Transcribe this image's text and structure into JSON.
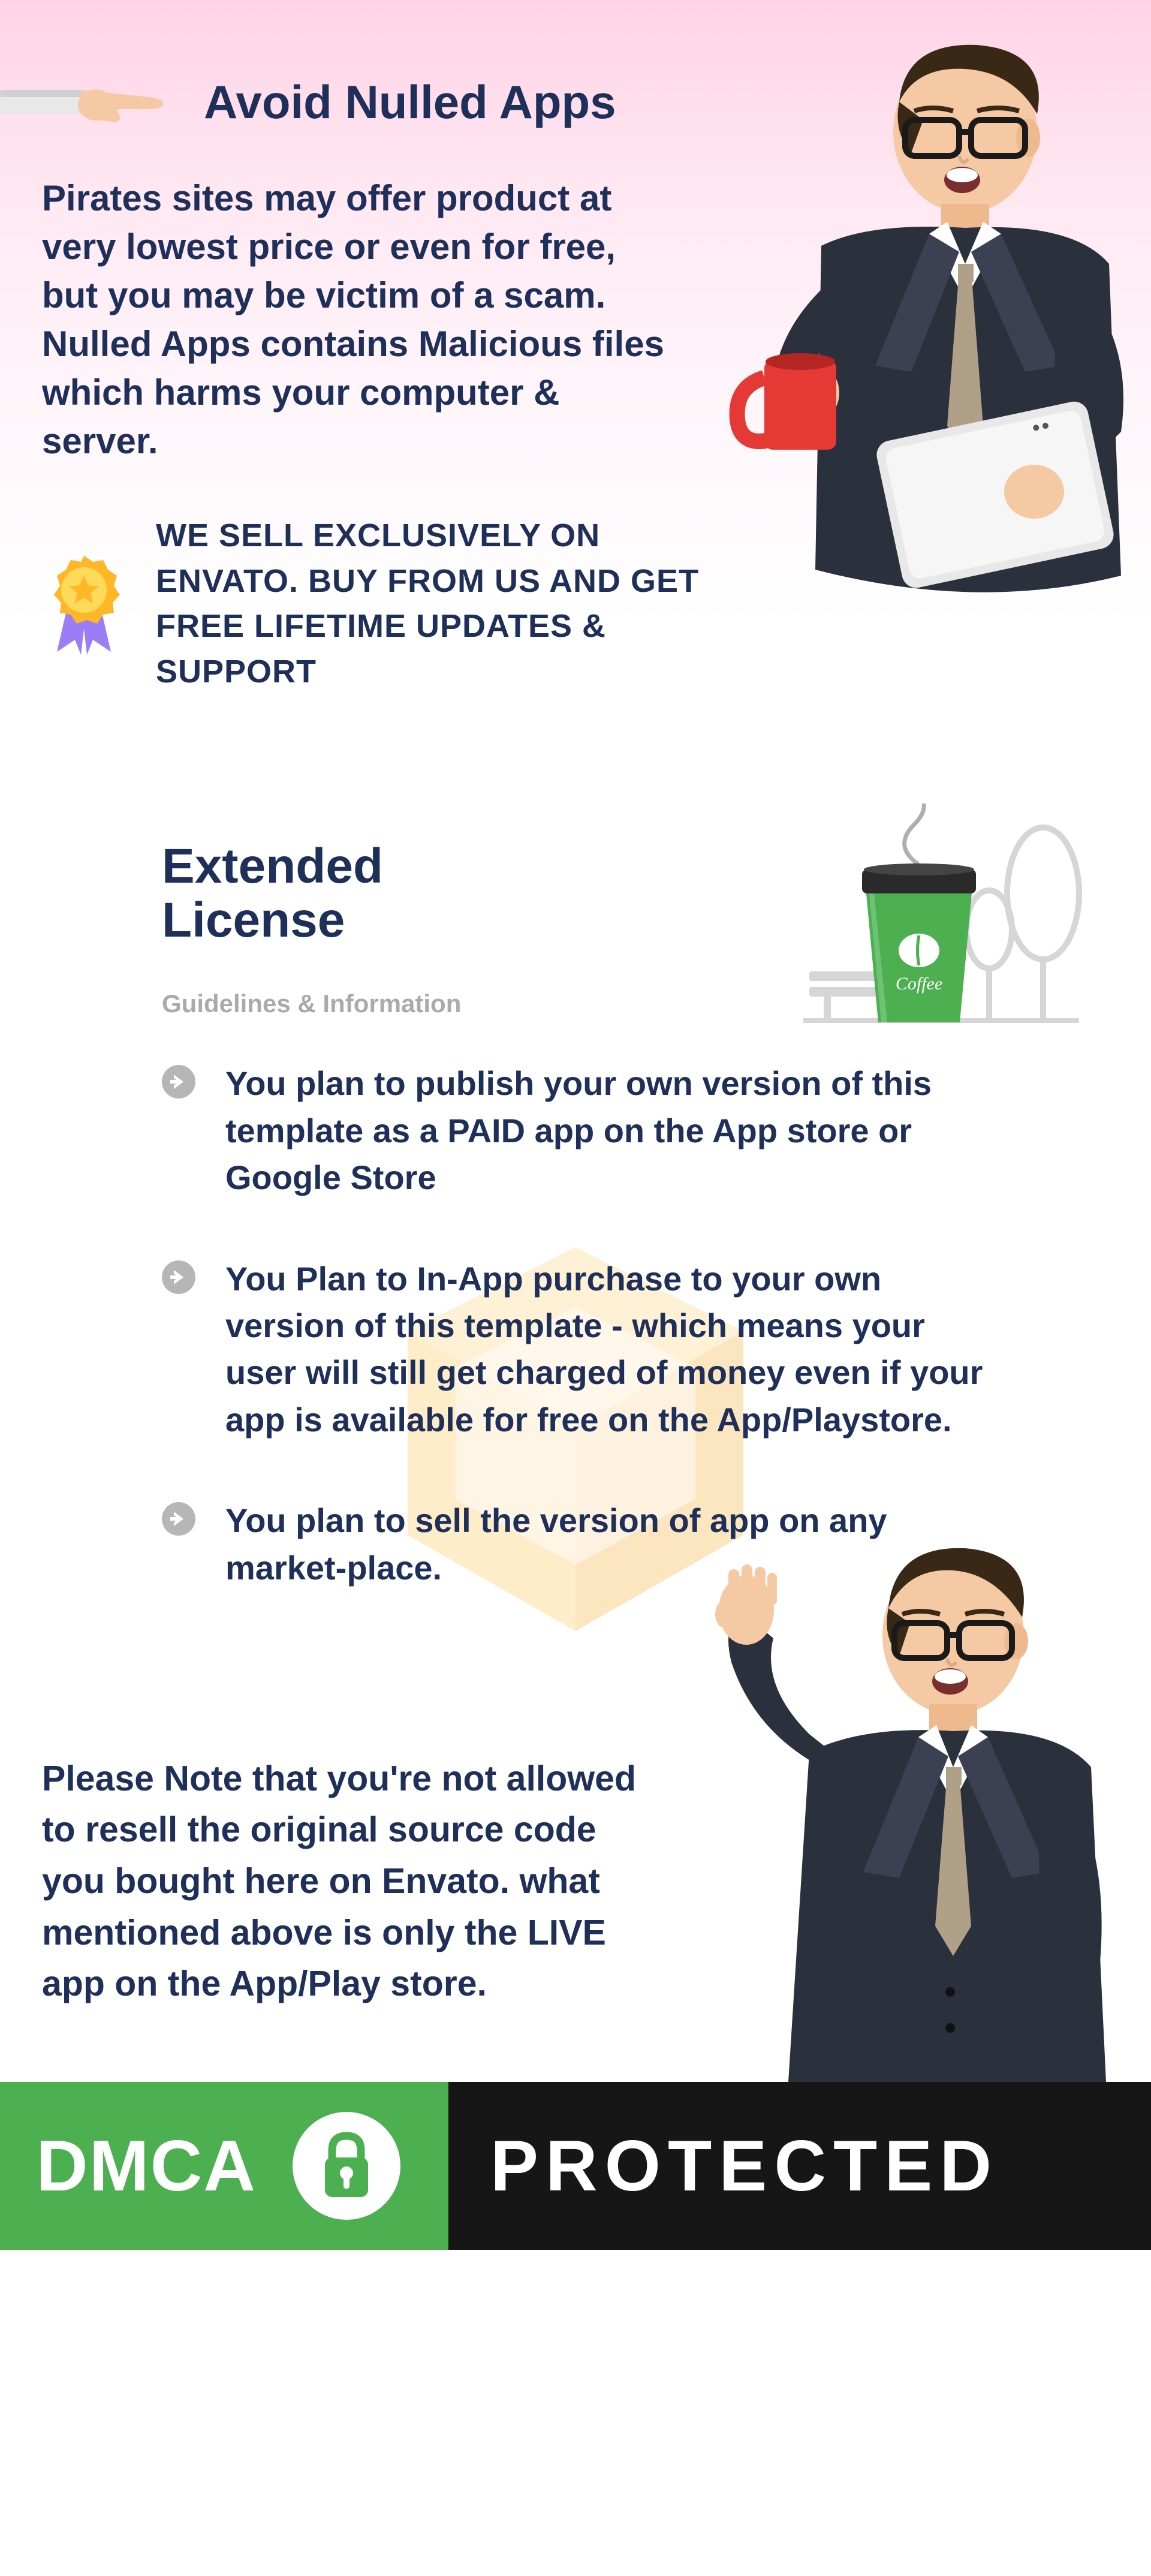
{
  "avoidNulled": {
    "title": "Avoid Nulled Apps",
    "body": "Pirates sites may offer product at very lowest price or even for free, but you may be victim of a scam. Nulled Apps contains Malicious files which harms your computer & server.",
    "exclusive": "WE SELL EXCLUSIVELY ON ENVATO. BUY FROM US AND GET FREE LIFETIME UPDATES & SUPPORT"
  },
  "license": {
    "titleLine1": "Extended",
    "titleLine2": "License",
    "subtitle": "Guidelines & Information",
    "bullets": [
      "You plan to publish your own version of this template as a PAID app on the App store or Google Store",
      "You Plan to In-App purchase to your own version of this template - which means your user will still get charged of money even if your app is available for free on the App/Playstore.",
      "You plan to sell the version of app on any market-place."
    ]
  },
  "note": "Please Note that you're not allowed to resell the original source code you bought here on Envato. what mentioned above is only the LIVE app on the App/Play store.",
  "dmca": {
    "left": "DMCA",
    "right": "PROTECTED"
  },
  "coffeeLabel": "Coffee"
}
